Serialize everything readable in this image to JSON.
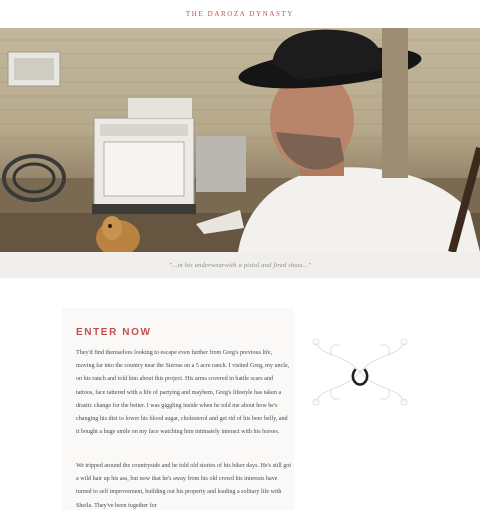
{
  "header": {
    "title": "THE DaROZA DYNASTY"
  },
  "hero": {
    "caption": "\"...in his underwearwith a pistol and fired shots...\""
  },
  "article": {
    "section_title": "ENTER NOW",
    "paragraph_1": "They'd find themselves looking to escape even further from Greg's previous life, moving far into the country near the Sierras on a 5 acre ranch. I visited Greg, my uncle, on his ranch and told him about this project. His arms covered in battle scars and tattoos, face tattered with a life of partying and mayhem, Greg's lifestyle has taken a drastic change for the better. I was giggling inside when he told me about how he's changing his diet to lower his blood sugar, cholesterol and get rid of his beer belly, and it bought a huge smile on my face watching him intimately interact with his horses.",
    "paragraph_2": "We tripped around the countryside and he told old stories of his biker days. He's still got a wild hair up his ass, but now that he's away from his old crowd his interests have turned to self improvement, building out his property and leading a solitary life with Sheila. They've been together for"
  },
  "colors": {
    "accent": "#c0504d",
    "caption_bg": "#f1efec",
    "panel_bg": "#faf9f8"
  },
  "icons": {
    "ornament": "floral-ornament-icon",
    "horseshoe": "horseshoe-icon"
  }
}
